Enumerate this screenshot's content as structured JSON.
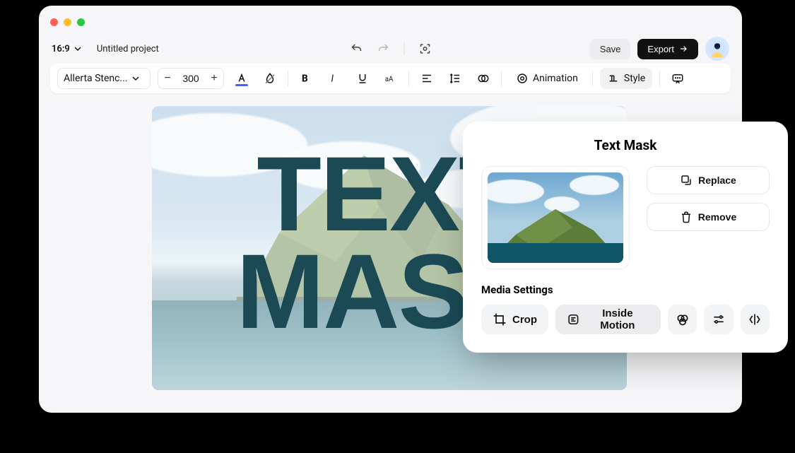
{
  "topbar": {
    "ratio": "16:9",
    "project_name": "Untitled project",
    "save_label": "Save",
    "export_label": "Export"
  },
  "toolbar": {
    "font_name": "Allerta Stenc...",
    "font_size": "300",
    "animation_label": "Animation",
    "style_label": "Style"
  },
  "canvas": {
    "text_line1": "TEXT",
    "text_line2": "MASK"
  },
  "panel": {
    "title": "Text Mask",
    "replace_label": "Replace",
    "remove_label": "Remove",
    "media_heading": "Media Settings",
    "crop_label": "Crop",
    "inside_motion_label": "Inside Motion"
  }
}
